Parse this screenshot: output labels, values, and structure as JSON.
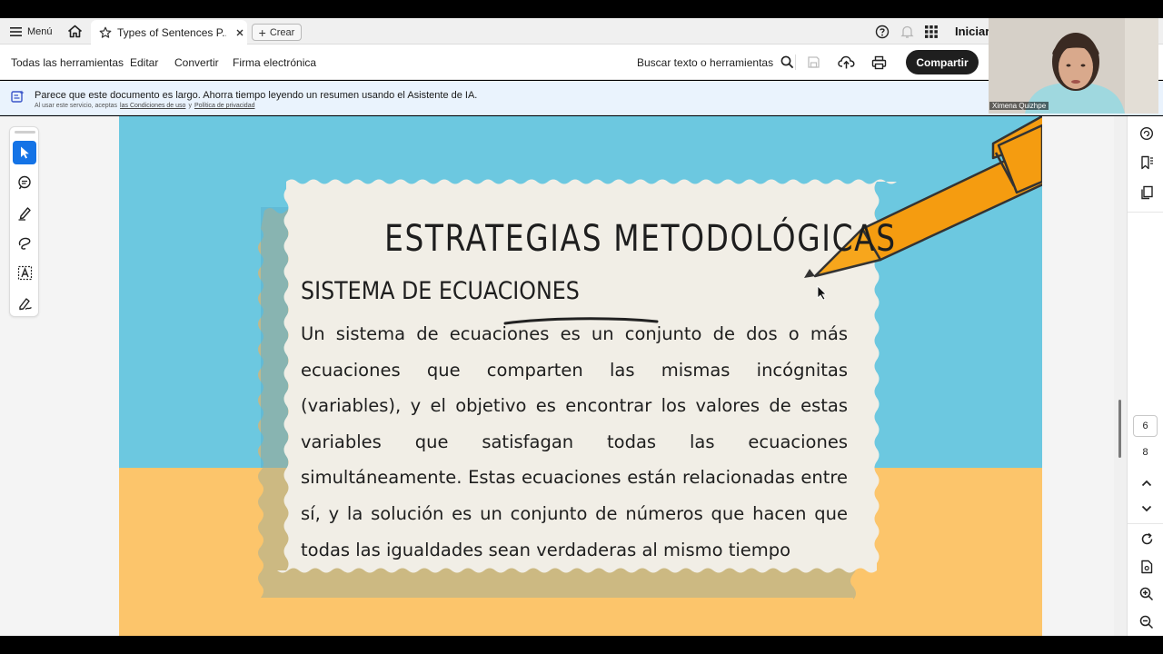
{
  "topbar": {
    "menu_label": "Menú",
    "tab_title": "Types of Sentences P...",
    "crear_label": "Crear",
    "iniciar_label": "Iniciar"
  },
  "toolbar": {
    "items": [
      "Todas las herramientas",
      "Editar",
      "Convertir",
      "Firma electrónica"
    ],
    "search_label": "Buscar texto o herramientas",
    "share_label": "Compartir"
  },
  "banner": {
    "message": "Parece que este documento es largo. Ahorra tiempo leyendo un resumen usando el Asistente de IA.",
    "sub_prefix": "Al usar este servicio, aceptas",
    "terms_link": "las Condiciones de uso",
    "sub_and": "y",
    "privacy_link": "Política de privacidad"
  },
  "slide": {
    "title": "ESTRATEGIAS METODOLÓGICAS",
    "subtitle": "SISTEMA DE ECUACIONES",
    "body": "Un sistema de ecuaciones es un conjunto de dos o más ecuaciones que comparten las mismas incógnitas (variables), y el objetivo es encontrar los valores de estas variables que satisfagan todas las ecuaciones simultáneamente. Estas ecuaciones están relacionadas entre sí, y la solución es un conjunto de números que hacen que todas las igualdades sean verdaderas al mismo tiempo",
    "colors": {
      "sky": "#6cc8e0",
      "sand": "#fcc56b",
      "paper": "#f1eee6",
      "pencil": "#f59c10"
    }
  },
  "pagination": {
    "current": "6",
    "total": "8"
  },
  "video": {
    "participant_name": "Ximena Quizhpe"
  }
}
